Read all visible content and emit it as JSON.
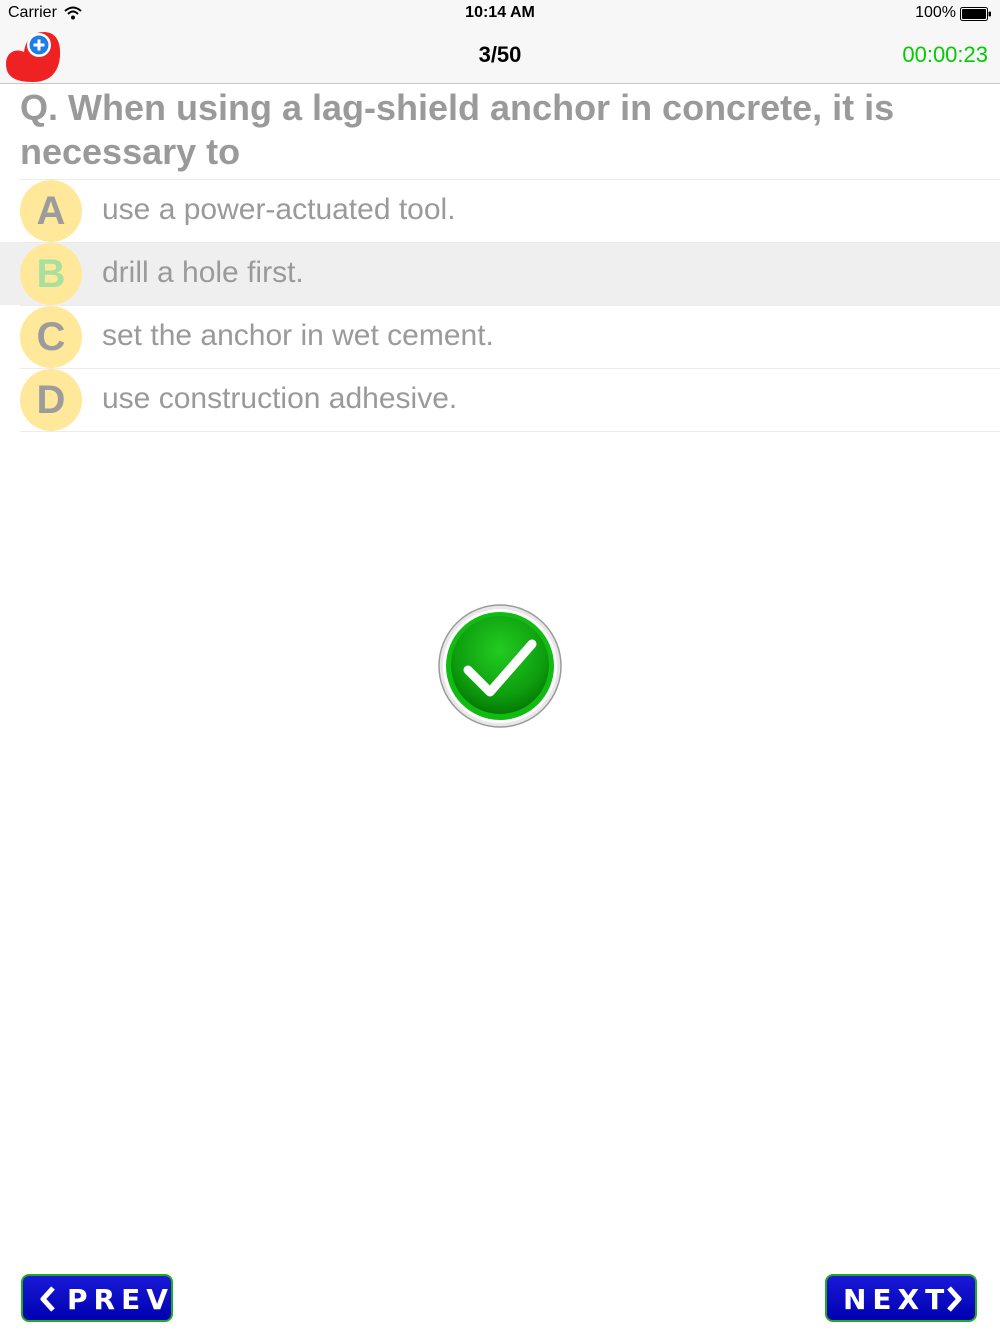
{
  "status_bar": {
    "carrier": "Carrier",
    "time": "10:14 AM",
    "battery": "100%"
  },
  "nav": {
    "counter": "3/50",
    "timer": "00:00:23",
    "timer_color": "#00cc00"
  },
  "question": {
    "text": "Q. When using a lag-shield anchor in concrete, it is necessary to"
  },
  "options": [
    {
      "letter": "A",
      "text": "use a power-actuated tool.",
      "selected": false
    },
    {
      "letter": "B",
      "text": "drill a hole first.",
      "selected": true
    },
    {
      "letter": "C",
      "text": "set the anchor in wet cement.",
      "selected": false
    },
    {
      "letter": "D",
      "text": "use construction adhesive.",
      "selected": false
    }
  ],
  "result": {
    "icon": "checkmark-icon",
    "correct": true
  },
  "footer": {
    "prev_label": "PREV",
    "next_label": "NEXT"
  },
  "colors": {
    "badge": "#ffe89a",
    "selected_row": "#efefef",
    "button_bg": "#0000c8",
    "button_border": "#22aa22",
    "check_green": "#11aa11"
  }
}
